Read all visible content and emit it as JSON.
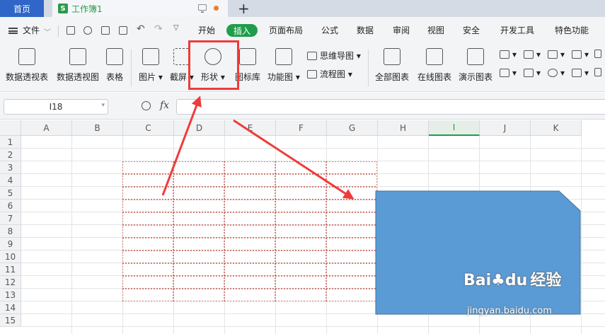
{
  "titlebar": {
    "home_tab": "首页",
    "doc_icon": "S",
    "doc_name": "工作簿1",
    "new_tab": "+"
  },
  "menu": {
    "file": "文件",
    "tabs": [
      "开始",
      "插入",
      "页面布局",
      "公式",
      "数据",
      "审阅",
      "视图",
      "安全",
      "开发工具",
      "特色功能"
    ],
    "active_tab": "插入"
  },
  "ribbon": {
    "buttons": [
      {
        "label": "数据透视表",
        "icon": "pivot-table-icon"
      },
      {
        "label": "数据透视图",
        "icon": "pivot-chart-icon"
      },
      {
        "label": "表格",
        "icon": "table-icon"
      },
      {
        "label": "图片",
        "icon": "picture-icon"
      },
      {
        "label": "截屏",
        "icon": "screenshot-icon"
      },
      {
        "label": "形状",
        "icon": "shape-icon"
      },
      {
        "label": "图标库",
        "icon": "icon-library-icon"
      },
      {
        "label": "功能图",
        "icon": "function-chart-icon"
      },
      {
        "label": "全部图表",
        "icon": "all-charts-icon"
      },
      {
        "label": "在线图表",
        "icon": "online-chart-icon"
      },
      {
        "label": "演示图表",
        "icon": "demo-chart-icon"
      }
    ],
    "small": [
      {
        "label": "思维导图",
        "icon": "mind-map-icon"
      },
      {
        "label": "流程图",
        "icon": "flowchart-icon"
      }
    ]
  },
  "formula_bar": {
    "cell_ref": "I18",
    "fx": "fx",
    "formula": ""
  },
  "sheet": {
    "columns": [
      "A",
      "B",
      "C",
      "D",
      "E",
      "F",
      "G",
      "H",
      "I",
      "J",
      "K"
    ],
    "active_column": "I",
    "rows": [
      "1",
      "2",
      "3",
      "4",
      "5",
      "6",
      "7",
      "8",
      "9",
      "10",
      "11",
      "12",
      "13",
      "14",
      "15"
    ]
  },
  "watermark": {
    "brand": "Bai",
    "brand_suffix": "经验",
    "url": "jingyan.baidu.com"
  },
  "colors": {
    "accent_green": "#1f9d4b",
    "highlight_red": "#ef3b3b",
    "shape_fill": "#5b9bd5",
    "dashed_border": "#c0392b"
  }
}
